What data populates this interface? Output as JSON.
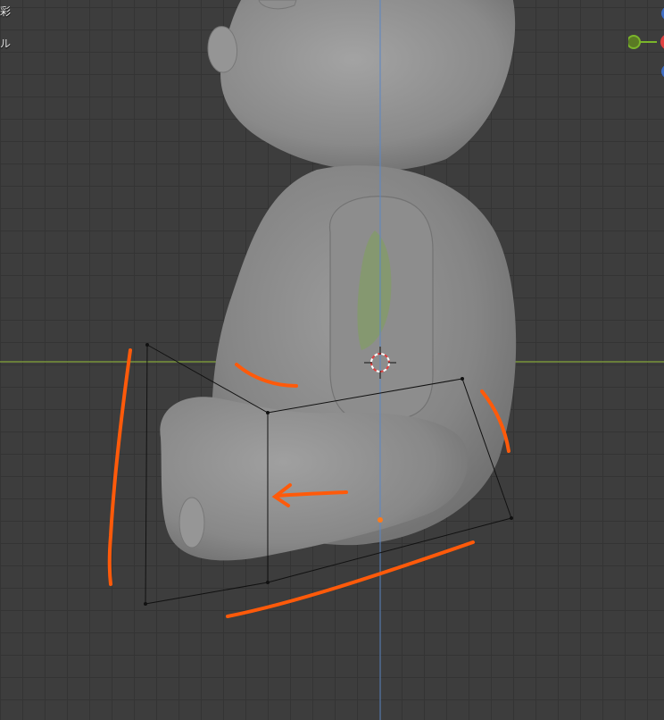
{
  "viewport": {
    "overlay_line_1": "彩",
    "overlay_line_2": "ル"
  },
  "colors": {
    "background": "#3d3d3d",
    "grid": "#343434",
    "x_axis": "#84a63a",
    "z_axis": "#5b86c4",
    "mesh": "#8c8c8c",
    "annotation": "#ff5a0a",
    "gizmo_x": "#e04040",
    "gizmo_y": "#7ab52a",
    "gizmo_z": "#3d6cc4"
  },
  "gizmo": {
    "axes": [
      "x-axis",
      "y-axis",
      "z-axis"
    ]
  }
}
